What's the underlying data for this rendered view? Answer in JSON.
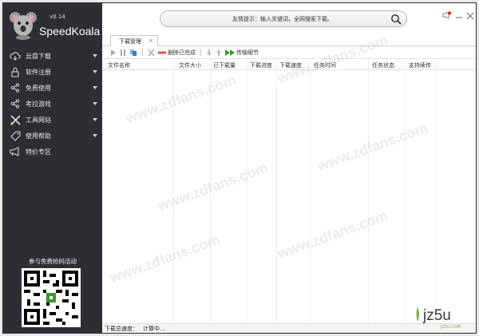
{
  "app": {
    "version": "v0.14",
    "name": "SpeedKoala"
  },
  "sidebar": {
    "items": [
      {
        "label": "云盘下载",
        "icon": "cloud-icon",
        "has_arrow": true
      },
      {
        "label": "软件注册",
        "icon": "lock-icon",
        "has_arrow": true
      },
      {
        "label": "免费使用",
        "icon": "share-icon",
        "has_arrow": true
      },
      {
        "label": "考拉游戏",
        "icon": "share-icon",
        "has_arrow": true
      },
      {
        "label": "工具网站",
        "icon": "tools-icon",
        "has_arrow": true
      },
      {
        "label": "使用帮助",
        "icon": "tag-icon",
        "has_arrow": true
      },
      {
        "label": "特价专区",
        "icon": "megaphone-icon",
        "has_arrow": false
      }
    ],
    "promo_text": "参与免费抢码活动"
  },
  "search": {
    "placeholder": "友情提示：输入关键词，全网搜索下载。"
  },
  "tabs": [
    {
      "label": "下载管理",
      "close": "×"
    }
  ],
  "toolbar": {
    "delete_completed": "删除已完成",
    "transfer_detail": "传输细节"
  },
  "table": {
    "columns": [
      "文件名称",
      "文件大小",
      "已下载量",
      "下载进度",
      "下载速度",
      "任务时间",
      "任务状态",
      "支持续传"
    ]
  },
  "status": {
    "label": "下载总速度：",
    "value": "计算中..."
  },
  "watermark": {
    "text": "www.zdfans.com",
    "brand": "jz5u",
    "brand_sub": "JZ5U.COM"
  },
  "colors": {
    "sidebar_bg": "#2d2e31",
    "accent_green": "#3a9b2c",
    "delete_red": "#d9534f"
  }
}
